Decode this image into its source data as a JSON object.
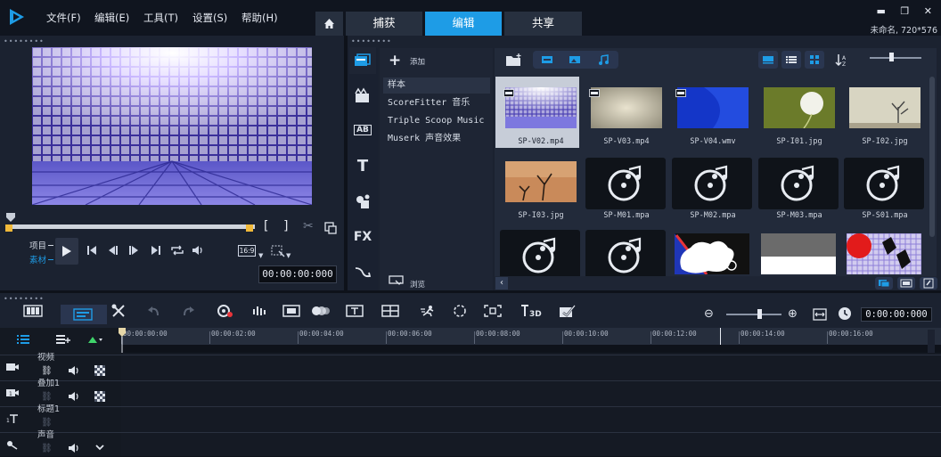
{
  "menu": [
    "文件(F)",
    "编辑(E)",
    "工具(T)",
    "设置(S)",
    "帮助(H)"
  ],
  "nav_tabs": {
    "capture": "捕获",
    "edit": "编辑",
    "share": "共享"
  },
  "project_info": "未命名, 720*576",
  "player": {
    "mode_project": "项目",
    "mode_clip": "素材",
    "aspect": "16:9",
    "timecode": "00:00:00:000",
    "scrub_position": 0.0
  },
  "library": {
    "add_label": "添加",
    "browse_label": "浏览",
    "side_labels": {
      "title": "AB",
      "text": "T",
      "fx": "FX"
    },
    "folders": [
      "样本",
      "ScoreFitter 音乐",
      "Triple Scoop Music",
      "Muserk 声音效果"
    ],
    "media": [
      {
        "name": "SP-V02.mp4",
        "kind": "video",
        "selected": true
      },
      {
        "name": "SP-V03.mp4",
        "kind": "video"
      },
      {
        "name": "SP-V04.wmv",
        "kind": "video"
      },
      {
        "name": "SP-I01.jpg",
        "kind": "image"
      },
      {
        "name": "SP-I02.jpg",
        "kind": "image"
      },
      {
        "name": "SP-I03.jpg",
        "kind": "image"
      },
      {
        "name": "SP-M01.mpa",
        "kind": "audio"
      },
      {
        "name": "SP-M02.mpa",
        "kind": "audio"
      },
      {
        "name": "SP-M03.mpa",
        "kind": "audio"
      },
      {
        "name": "SP-S01.mpa",
        "kind": "audio"
      },
      {
        "name": "",
        "kind": "audio"
      },
      {
        "name": "",
        "kind": "audio"
      },
      {
        "name": "",
        "kind": "template"
      },
      {
        "name": "",
        "kind": "gray"
      },
      {
        "name": "",
        "kind": "template2"
      }
    ]
  },
  "timeline": {
    "timecode": "0:00:00:000",
    "ruler": [
      "00:00:00:00",
      "00:00:02:00",
      "00:00:04:00",
      "00:00:06:00",
      "00:00:08:00",
      "00:00:10:00",
      "00:00:12:00",
      "00:00:14:00",
      "00:00:16:00"
    ],
    "tracks": [
      {
        "name": "视频",
        "icon": "video-track-icon"
      },
      {
        "name": "叠加1",
        "icon": "overlay-track-icon"
      },
      {
        "name": "标题1",
        "icon": "title-track-icon"
      },
      {
        "name": "声音",
        "icon": "voice-track-icon"
      }
    ],
    "text_3d_label": "3D"
  },
  "colors": {
    "accent": "#1e9ce6",
    "panel": "#1b2230",
    "background": "#0e121a"
  }
}
